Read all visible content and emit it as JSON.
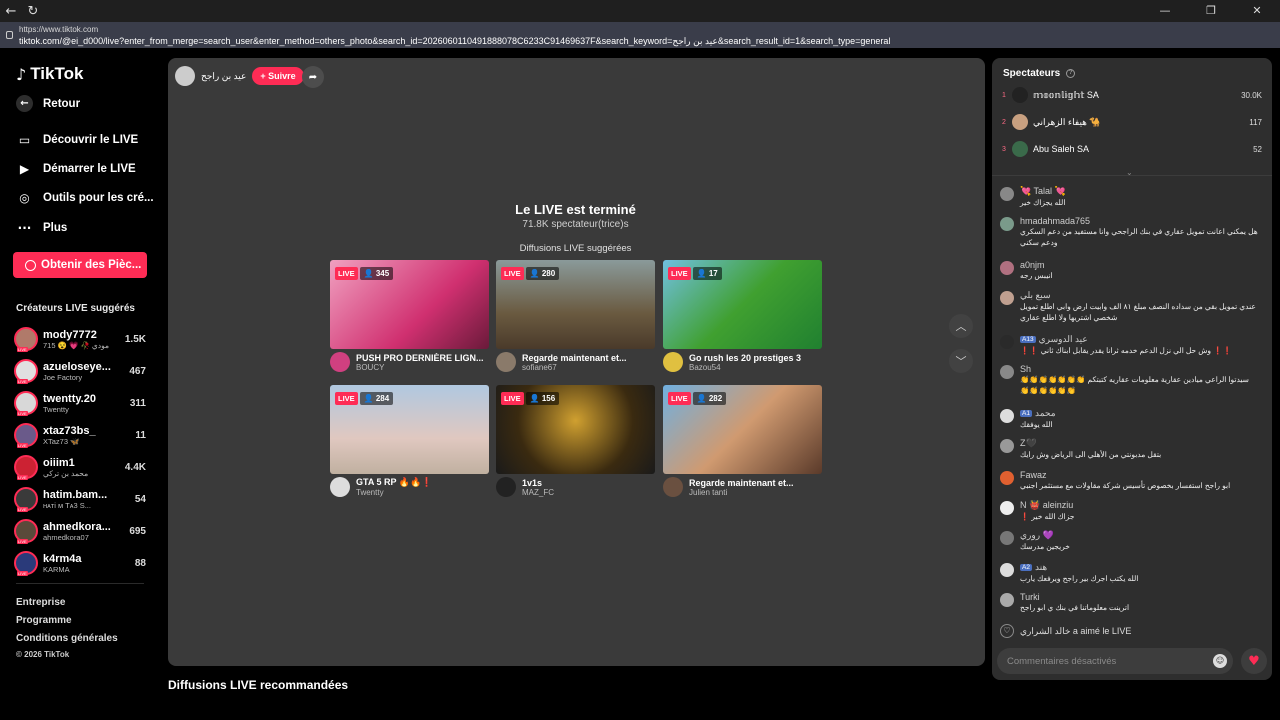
{
  "browser": {
    "url_short": "https://www.tiktok.com",
    "url_full": "tiktok.com/@ei_d000/live?enter_from_merge=search_user&enter_method=others_photo&search_id=2026060110491888078C6233C91469637F&search_keyword=عيد بن راجح&search_result_id=1&search_type=general",
    "back_icon": "←",
    "reload_icon": "↻",
    "minimize": "—",
    "restore": "❐",
    "close": "✕"
  },
  "sidebar": {
    "logo_text": "TikTok",
    "logo_icon": "♪",
    "nav": [
      {
        "label": "Retour",
        "icon": "←"
      },
      {
        "label": "Découvrir le LIVE",
        "icon": "▭"
      },
      {
        "label": "Démarrer le LIVE",
        "icon": "▶"
      },
      {
        "label": "Outils pour les cré...",
        "icon": "◎"
      },
      {
        "label": "Plus",
        "icon": "···"
      }
    ],
    "coin_button": "Obtenir des Pièc...",
    "suggested_title": "Créateurs LIVE suggérés",
    "creators": [
      {
        "name": "mody7772",
        "sub": "715 😵 💗 🥀 مودي",
        "count": "1.5K",
        "color": "#b07a6a"
      },
      {
        "name": "azueloseye...",
        "sub": "Joe Factory",
        "count": "467",
        "color": "#e0e0e0"
      },
      {
        "name": "twentty.20",
        "sub": "Twentty",
        "count": "311",
        "color": "#d8d8d8"
      },
      {
        "name": "xtaz73bs_",
        "sub": "XTaz73 🦋",
        "count": "11",
        "color": "#6a5a8a"
      },
      {
        "name": "oiiim1",
        "sub": "محمد بن تركي",
        "count": "4.4K",
        "color": "#cc2233"
      },
      {
        "name": "hatim.bam...",
        "sub": "ʜᴀтi ᴍ Tᴀ3 S...",
        "count": "54",
        "color": "#3a3a3a"
      },
      {
        "name": "ahmedkora...",
        "sub": "ahmedkora07",
        "count": "695",
        "color": "#5a4a3a"
      },
      {
        "name": "k4rm4a",
        "sub": "KARMA",
        "count": "88",
        "color": "#2a3a7a"
      }
    ],
    "footer": [
      "Entreprise",
      "Programme",
      "Conditions générales"
    ],
    "copyright": "© 2026 TikTok"
  },
  "player": {
    "host_name": "عيد بن راجح",
    "follow": "+ Suivre",
    "share_icon": "➦",
    "ended_title": "Le LIVE est terminé",
    "viewers": "71.8K spectateur(trice)s",
    "suggested": "Diffusions LIVE suggérées",
    "live_label": "LIVE",
    "cards": [
      {
        "title": "PUSH PRO DERNIÈRE LIGN...",
        "user": "BOUCY",
        "viewers": "345",
        "bg": "linear-gradient(135deg,#f0a0c0,#d03070 60%,#6a1a3a)",
        "avatar": "#d04080"
      },
      {
        "title": "Regarde maintenant et...",
        "user": "sofiane67",
        "viewers": "280",
        "bg": "linear-gradient(180deg,#8a9a9a,#6a5a40 60%,#4a3a2a)",
        "avatar": "#8a7a6a"
      },
      {
        "title": "Go rush les 20 prestiges 3",
        "user": "Bazou54",
        "viewers": "17",
        "bg": "linear-gradient(135deg,#70c0e0,#40a030 50%,#208030)",
        "avatar": "#e0c040"
      },
      {
        "title": "GTA 5 RP 🔥🔥❗",
        "user": "Twentty",
        "viewers": "284",
        "bg": "linear-gradient(180deg,#b0c8e0,#e0c8c0 60%,#c0b0a0)",
        "avatar": "#dddddd"
      },
      {
        "title": "1v1s",
        "user": "MAZ_FC",
        "viewers": "156",
        "bg": "radial-gradient(circle at 50% 40%,#d0a030,#3a2a10 60%,#1a1a1a)",
        "avatar": "#222222"
      },
      {
        "title": "Regarde maintenant et...",
        "user": "Julien tanti",
        "viewers": "282",
        "bg": "linear-gradient(135deg,#70b0e0,#d09a70 50%,#5a3a2a)",
        "avatar": "#6a5040"
      }
    ],
    "up_icon": "︿",
    "down_icon": "﹀"
  },
  "recommended_title": "Diffusions LIVE recommandées",
  "spectators": {
    "title": "Spectateurs",
    "info_icon": "?",
    "rows": [
      {
        "rank": "1",
        "name": "𝕞𝕠𝕠𝕟𝕝𝕚𝕘𝕙𝕥 SA",
        "score": "30.0K"
      },
      {
        "rank": "2",
        "name": "هيفاء الزهراني 🐪",
        "score": "117"
      },
      {
        "rank": "3",
        "name": "Abu Saleh SA",
        "score": "52"
      }
    ],
    "chevron": "⌄"
  },
  "chat": [
    {
      "name": "💘 Talal 💘",
      "text": "الله يجزاك خير",
      "lvl": ""
    },
    {
      "name": "hmadahmada765",
      "text": "هل يمكني اعانت تمويل عقاري في بنك الراجحي وانا مستفيد من دعم السكري ودعم سكني",
      "lvl": ""
    },
    {
      "name": "a0njm",
      "text": "انيبس رجه",
      "lvl": ""
    },
    {
      "name": "سبع بلي",
      "text": "عندي تمويل بقي من سداده النصف مبلغ ٨١ الف وابيت ارض وابي اطلع تمويل شخصي اشتريها ولا اطلع عقاري",
      "lvl": ""
    },
    {
      "name": "عيد الدوسري",
      "text": "❗❗ وش حل الي نزل الدعم خدمه ثرانا يقدر يقابل ابناك ثاني ❗❗",
      "lvl": "13"
    },
    {
      "name": "Sh",
      "text": "سيدتوا الراعي ميادين عقارية معلومات عقاريه كتبتكم 👏👏👏👏👏👏👏👏👏👏👏👏👏",
      "lvl": ""
    },
    {
      "name": "محمد",
      "text": "الله يوفقك",
      "lvl": "1"
    },
    {
      "name": "Z🖤",
      "text": "بتقل مدبونتي من الأهلي الى الرياض وش رايك",
      "lvl": ""
    },
    {
      "name": "Fawaz",
      "text": "ابو راجح استفسار بخصوص تأسيس شركة مقاولات مع مستثمر اجنبي",
      "lvl": ""
    },
    {
      "name": "N 👹 aleinziu",
      "text": "جزاك الله خير ❗",
      "lvl": ""
    },
    {
      "name": "روري 💜",
      "text": "خريجين مدرسك",
      "lvl": ""
    },
    {
      "name": "هند",
      "text": "الله يكتب اجرك بير راجح ويرفعك يارب",
      "lvl": "2"
    },
    {
      "name": "Turki",
      "text": "اترينت معلوماتنا في بنك ي ابو راجح",
      "lvl": ""
    }
  ],
  "like_text": "خالد الشراري a aimé le LIVE",
  "like_icon": "♡",
  "comment_placeholder": "Commentaires désactivés",
  "emoji_icon": "☺",
  "heart_icon": "♥"
}
